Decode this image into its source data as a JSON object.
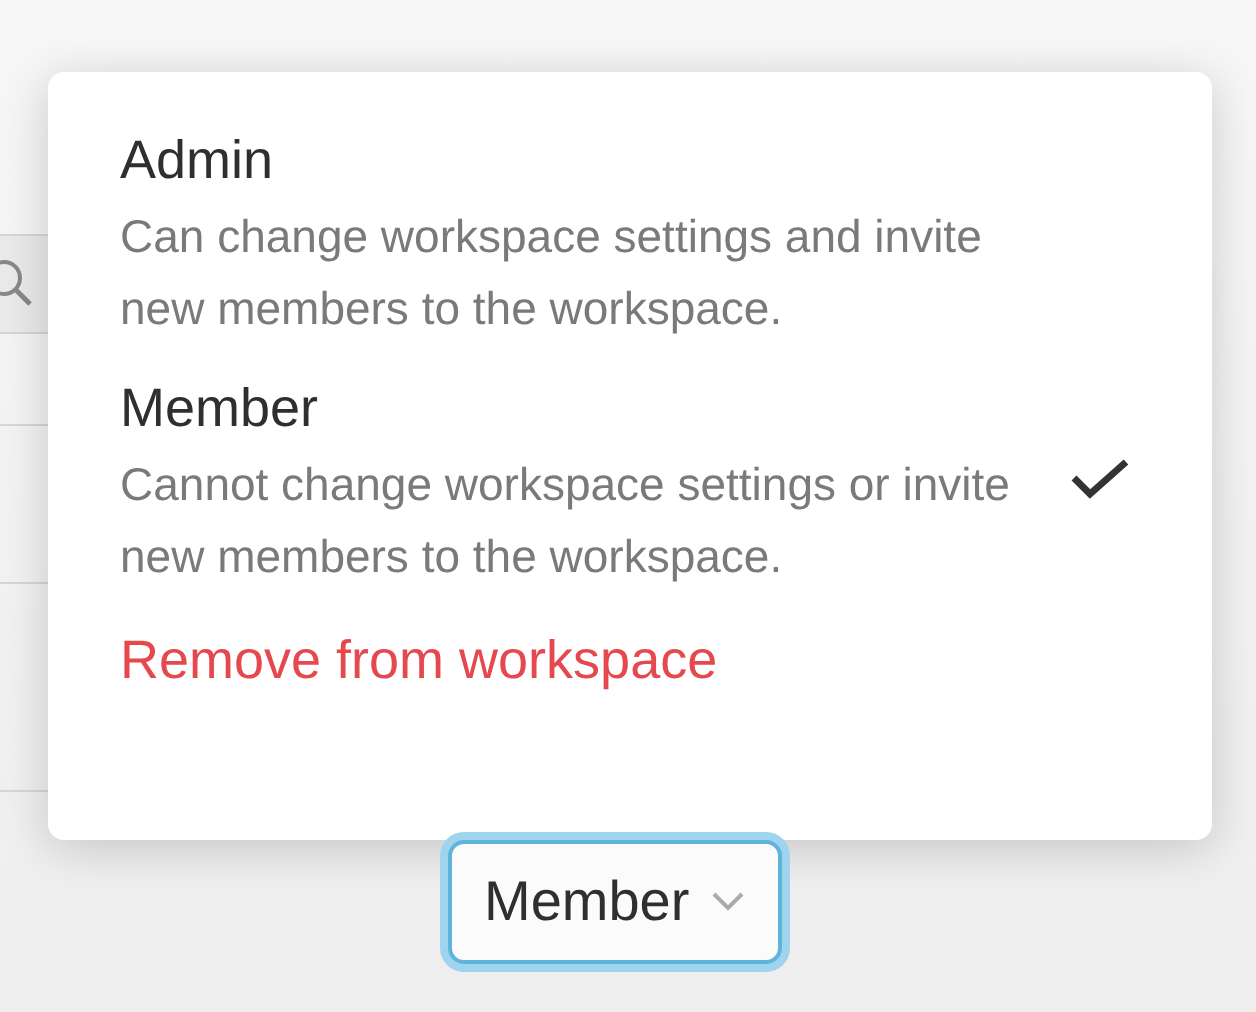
{
  "role_menu": {
    "options": [
      {
        "title": "Admin",
        "description": "Can change workspace settings and invite new members to the workspace.",
        "selected": false
      },
      {
        "title": "Member",
        "description": "Cannot change workspace settings or invite new members to the workspace.",
        "selected": true
      }
    ],
    "remove_action": "Remove from workspace"
  },
  "role_button": {
    "label": "Member",
    "focused": true
  }
}
